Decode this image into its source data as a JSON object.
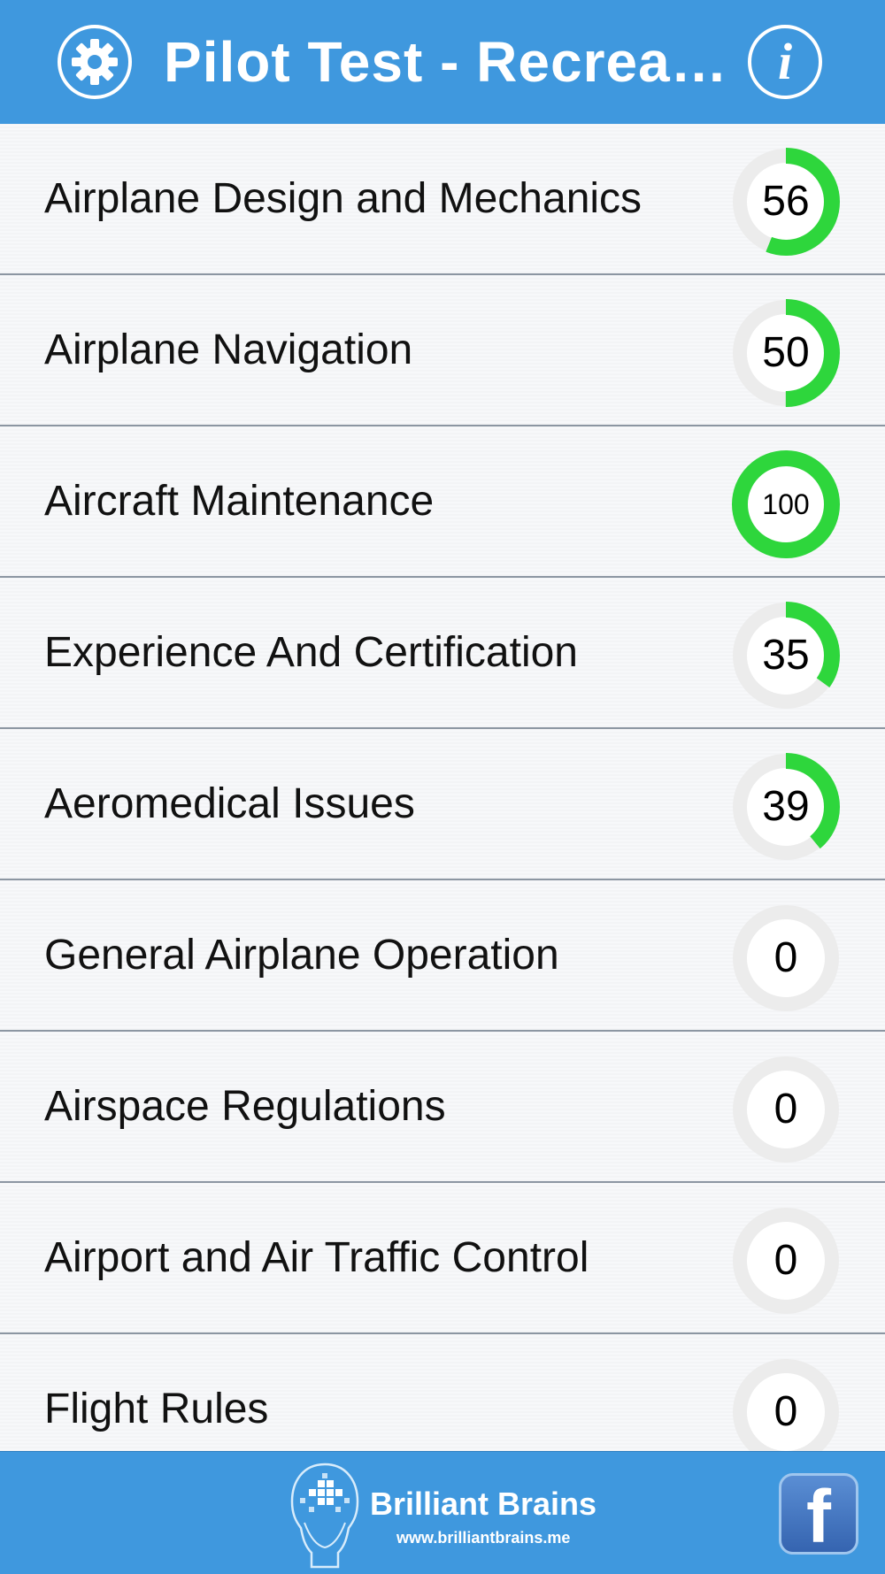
{
  "header": {
    "title": "Pilot Test - Recreati…",
    "settings_icon": "gear-icon",
    "info_icon": "info-icon",
    "info_glyph": "i"
  },
  "categories": [
    {
      "label": "Airplane Design and Mechanics",
      "score": "56",
      "progress": 56
    },
    {
      "label": "Airplane Navigation",
      "score": "50",
      "progress": 50
    },
    {
      "label": "Aircraft Maintenance",
      "score": "100",
      "progress": 100
    },
    {
      "label": "Experience And Certification",
      "score": "35",
      "progress": 35
    },
    {
      "label": "Aeromedical Issues",
      "score": "39",
      "progress": 39
    },
    {
      "label": "General Airplane Operation",
      "score": "0",
      "progress": 0
    },
    {
      "label": "Airspace Regulations",
      "score": "0",
      "progress": 0
    },
    {
      "label": "Airport and Air Traffic Control",
      "score": "0",
      "progress": 0
    },
    {
      "label": "Flight Rules",
      "score": "0",
      "progress": 0
    }
  ],
  "footer": {
    "brand_name": "Brilliant Brains",
    "brand_url": "www.brilliantbrains.me",
    "facebook_glyph": "f",
    "logo_icon": "brain-head-logo",
    "facebook_icon": "facebook-icon"
  },
  "colors": {
    "header_bg": "#3f98de",
    "progress": "#2ed63c",
    "track": "#ececec",
    "row_divider": "#8c96a2"
  }
}
